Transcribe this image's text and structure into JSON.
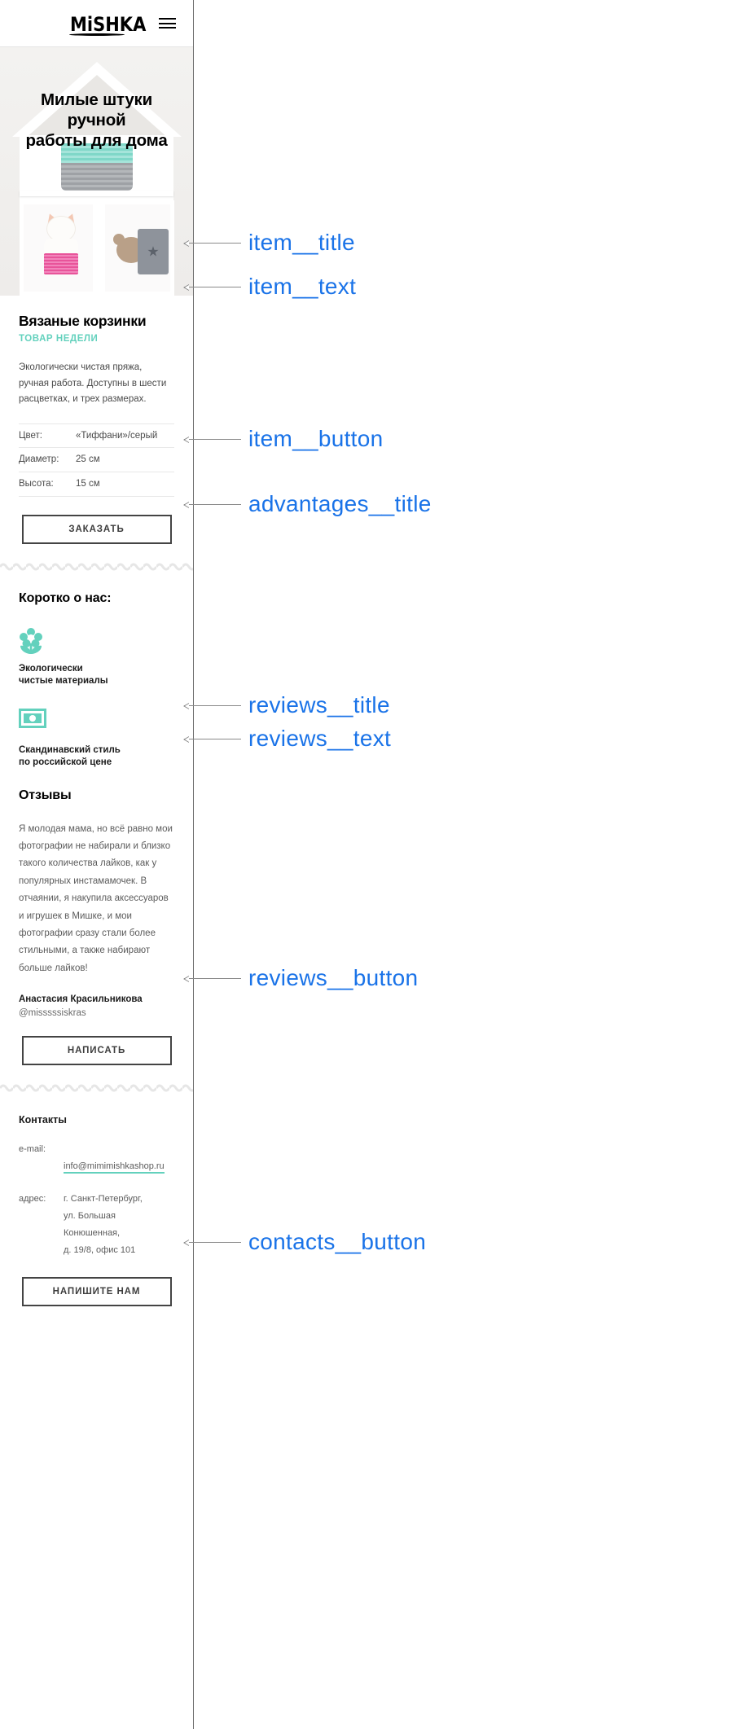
{
  "header": {
    "logo": "MiSHKA",
    "menu_icon": "hamburger-menu-icon"
  },
  "hero": {
    "title": "Милые штуки\nручной\nработы для дома"
  },
  "item": {
    "title": "Вязаные корзинки",
    "label": "ТОВАР НЕДЕЛИ",
    "text": "Экологически чистая пряжа, ручная работа. Доступны в шести расцветках, и трех размерах.",
    "features": [
      {
        "key": "Цвет:",
        "value": "«Тиффани»/серый"
      },
      {
        "key": "Диаметр:",
        "value": "25 см"
      },
      {
        "key": "Высота:",
        "value": "15 см"
      }
    ],
    "button": "ЗАКАЗАТЬ"
  },
  "advantages": {
    "title": "Коротко о нас:",
    "items": [
      {
        "icon": "flower-icon",
        "text": "Экологически\nчистые материалы"
      },
      {
        "icon": "banknote-icon",
        "text": "Скандинавский стиль\nпо российской цене"
      }
    ]
  },
  "reviews": {
    "title": "Отзывы",
    "text": "Я молодая мама, но всё равно мои фотографии не набирали и близко такого количества лайков, как у популярных инстамамочек. В отчаянии, я накупила аксессуаров и игрушек в Мишке, и мои фотографии сразу стали более стильными, а также набирают больше лайков!",
    "author": "Анастасия Красильникова",
    "handle": "@misssssiskras",
    "button": "НАПИСАТЬ"
  },
  "contacts": {
    "title": "Контакты",
    "email_key": "e-mail:",
    "email_value": "info@mimimishkashop.ru",
    "address_key": "адрес:",
    "address_value": "г. Санкт-Петербург,\nул. Большая\nКонюшенная,\nд. 19/8, офис 101",
    "button": "НАПИШИТЕ НАМ"
  },
  "annotations": [
    {
      "label": "item__title"
    },
    {
      "label": "item__text"
    },
    {
      "label": "item__button"
    },
    {
      "label": "advantages__title"
    },
    {
      "label": "reviews__title"
    },
    {
      "label": "reviews__text"
    },
    {
      "label": "reviews__button"
    },
    {
      "label": "contacts__button"
    }
  ],
  "colors": {
    "accent": "#63d1bd",
    "annotation": "#1a73e8",
    "text": "#4a4a4a"
  }
}
